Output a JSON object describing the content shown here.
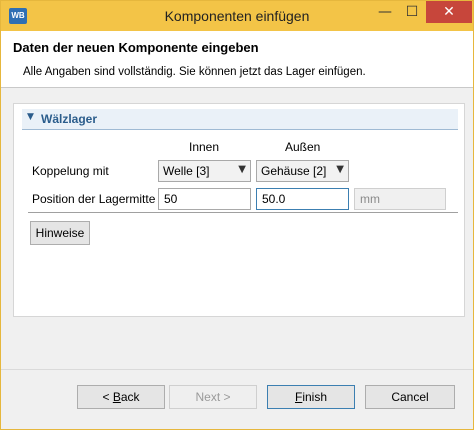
{
  "window": {
    "title": "Komponenten einfügen",
    "app_icon_text": "WB",
    "minimize_glyph": "—",
    "maximize_glyph": "☐",
    "close_glyph": "✕"
  },
  "header": {
    "title": "Daten der neuen Komponente eingeben",
    "description": "Alle Angaben sind vollständig. Sie können jetzt das Lager einfügen."
  },
  "section": {
    "title": "Wälzlager",
    "expanded": true
  },
  "columns": {
    "inner": "Innen",
    "outer": "Außen"
  },
  "coupling": {
    "label": "Koppelung mit",
    "inner_selected": "Welle [3]",
    "outer_selected": "Gehäuse [2]"
  },
  "position": {
    "label": "Position der Lagermitte",
    "inner_value": "50",
    "outer_value": "50.0",
    "unit": "mm"
  },
  "buttons": {
    "hints": "Hinweise",
    "back_prefix": "< ",
    "back_mnemonic": "B",
    "back_rest": "ack",
    "next": "Next >",
    "finish_mnemonic": "F",
    "finish_rest": "inish",
    "cancel": "Cancel"
  }
}
